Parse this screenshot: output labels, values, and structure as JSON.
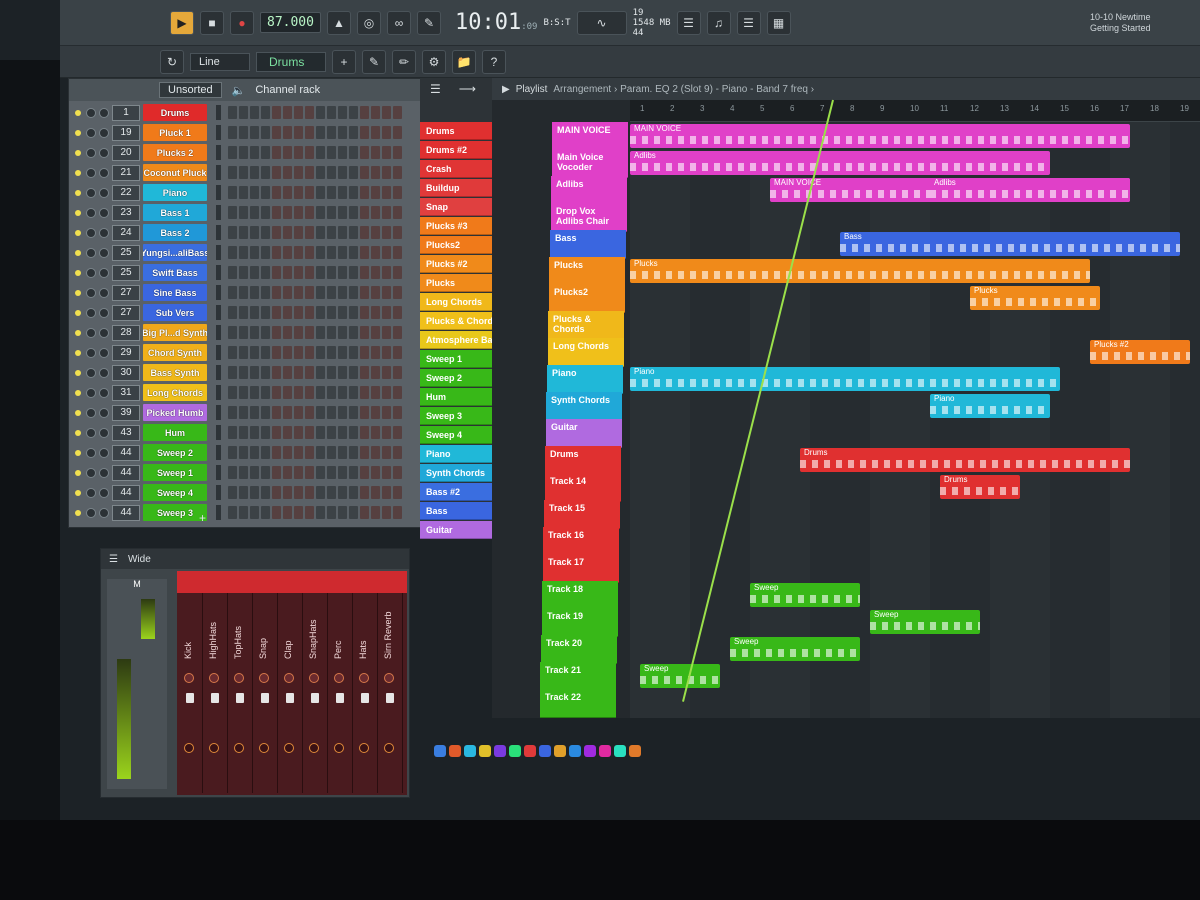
{
  "transport": {
    "tempo": "87.000",
    "time": "10:01",
    "time_sub": ":09",
    "time_label": "B:S:T",
    "cpu": "19",
    "memory": "1548 MB",
    "voices": "44",
    "news": "10-10 Newtime Getting Started"
  },
  "subbar": {
    "snap": "Line",
    "pattern": "Drums"
  },
  "rack": {
    "filter": "Unsorted",
    "title": "Channel rack",
    "add_label": "+",
    "channels": [
      {
        "num": "1",
        "name": "Drums",
        "color": "#e02a2a"
      },
      {
        "num": "19",
        "name": "Pluck 1",
        "color": "#f07a1a"
      },
      {
        "num": "20",
        "name": "Plucks 2",
        "color": "#f07a1a"
      },
      {
        "num": "21",
        "name": "Coconut Pluck",
        "color": "#f08a1a"
      },
      {
        "num": "22",
        "name": "Piano",
        "color": "#20b8d8"
      },
      {
        "num": "23",
        "name": "Bass 1",
        "color": "#20a8d8"
      },
      {
        "num": "24",
        "name": "Bass 2",
        "color": "#2098d8"
      },
      {
        "num": "25",
        "name": "Yungsi...aliBass",
        "color": "#3a6ee0"
      },
      {
        "num": "25",
        "name": "Swift Bass",
        "color": "#3a6ee0"
      },
      {
        "num": "27",
        "name": "Sine Bass",
        "color": "#3a66e0"
      },
      {
        "num": "27",
        "name": "Sub Vers",
        "color": "#3a66e0"
      },
      {
        "num": "28",
        "name": "Big Pl...d Synth",
        "color": "#f0a81a"
      },
      {
        "num": "29",
        "name": "Chord Synth",
        "color": "#f0b01a"
      },
      {
        "num": "30",
        "name": "Bass Synth",
        "color": "#f0b81a"
      },
      {
        "num": "31",
        "name": "Long Chords",
        "color": "#f0c01a"
      },
      {
        "num": "39",
        "name": "Picked Humb",
        "color": "#b06ae0"
      },
      {
        "num": "43",
        "name": "Hum",
        "color": "#38b818"
      },
      {
        "num": "44",
        "name": "Sweep 2",
        "color": "#38b818"
      },
      {
        "num": "44",
        "name": "Sweep 1",
        "color": "#38b818"
      },
      {
        "num": "44",
        "name": "Sweep 4",
        "color": "#38b818"
      },
      {
        "num": "44",
        "name": "Sweep 3",
        "color": "#38b818"
      }
    ]
  },
  "mixer": {
    "title": "Wide",
    "master_label": "M",
    "strips": [
      "Kick",
      "HighHats",
      "TopHats",
      "Snap",
      "Clap",
      "SnapHats",
      "Perc",
      "Hats",
      "Sirn Reverb"
    ]
  },
  "tracklist": {
    "items": [
      {
        "name": "Drums",
        "color": "#e03030"
      },
      {
        "name": "Drums #2",
        "color": "#e03030"
      },
      {
        "name": "Crash",
        "color": "#e03535"
      },
      {
        "name": "Buildup",
        "color": "#e03a3a"
      },
      {
        "name": "Snap",
        "color": "#e04040"
      },
      {
        "name": "Plucks #3",
        "color": "#f07a1a"
      },
      {
        "name": "Plucks2",
        "color": "#f07a1a"
      },
      {
        "name": "Plucks #2",
        "color": "#f08a1a"
      },
      {
        "name": "Plucks",
        "color": "#f08a1a"
      },
      {
        "name": "Long Chords",
        "color": "#f0b81a"
      },
      {
        "name": "Plucks & Chords",
        "color": "#f0c01a"
      },
      {
        "name": "Atmosphere Bass",
        "color": "#e8c81a"
      },
      {
        "name": "Sweep 1",
        "color": "#38b818"
      },
      {
        "name": "Sweep 2",
        "color": "#38b818"
      },
      {
        "name": "Hum",
        "color": "#38b818"
      },
      {
        "name": "Sweep 3",
        "color": "#38b818"
      },
      {
        "name": "Sweep 4",
        "color": "#38b818"
      },
      {
        "name": "Piano",
        "color": "#20b8d8"
      },
      {
        "name": "Synth Chords",
        "color": "#20a8d8"
      },
      {
        "name": "Bass #2",
        "color": "#3a6ee0"
      },
      {
        "name": "Bass",
        "color": "#3a66e0"
      },
      {
        "name": "Guitar",
        "color": "#b06ae0"
      }
    ]
  },
  "playlist": {
    "toolbar_title": "Playlist",
    "breadcrumb": "Arrangement › Param. EQ 2 (Slot 9) - Piano - Band 7 freq ›",
    "tracks": [
      {
        "name": "MAIN VOICE",
        "color": "#e040c8"
      },
      {
        "name": "Main Voice Vocoder",
        "color": "#e040c8"
      },
      {
        "name": "Adlibs",
        "color": "#e040c8"
      },
      {
        "name": "Drop Vox Adlibs Chair",
        "color": "#e040c8"
      },
      {
        "name": "Bass",
        "color": "#3a66e0"
      },
      {
        "name": "Plucks",
        "color": "#f08a1a"
      },
      {
        "name": "Plucks2",
        "color": "#f08a1a"
      },
      {
        "name": "Plucks & Chords",
        "color": "#f0b81a"
      },
      {
        "name": "Long Chords",
        "color": "#f0c01a"
      },
      {
        "name": "Piano",
        "color": "#20b8d8"
      },
      {
        "name": "Synth Chords",
        "color": "#20a8d8"
      },
      {
        "name": "Guitar",
        "color": "#b06ae0"
      },
      {
        "name": "Drums",
        "color": "#e03030"
      },
      {
        "name": "Track 14",
        "color": "#e03030"
      },
      {
        "name": "Track 15",
        "color": "#e03030"
      },
      {
        "name": "Track 16",
        "color": "#e03030"
      },
      {
        "name": "Track 17",
        "color": "#e03030"
      },
      {
        "name": "Track 18",
        "color": "#38b818"
      },
      {
        "name": "Track 19",
        "color": "#38b818"
      },
      {
        "name": "Track 20",
        "color": "#38b818"
      },
      {
        "name": "Track 21",
        "color": "#38b818"
      },
      {
        "name": "Track 22",
        "color": "#38b818"
      }
    ],
    "clips": [
      {
        "label": "MAIN VOICE",
        "color": "#e040c8"
      },
      {
        "label": "Adlibs",
        "color": "#e040c8"
      },
      {
        "label": "Bass",
        "color": "#3a66e0"
      },
      {
        "label": "Plucks",
        "color": "#f08a1a"
      },
      {
        "label": "Plucks #2",
        "color": "#f07a1a"
      },
      {
        "label": "Piano",
        "color": "#20b8d8"
      },
      {
        "label": "Drums",
        "color": "#e03030"
      },
      {
        "label": "Sweep",
        "color": "#38b818"
      }
    ]
  }
}
